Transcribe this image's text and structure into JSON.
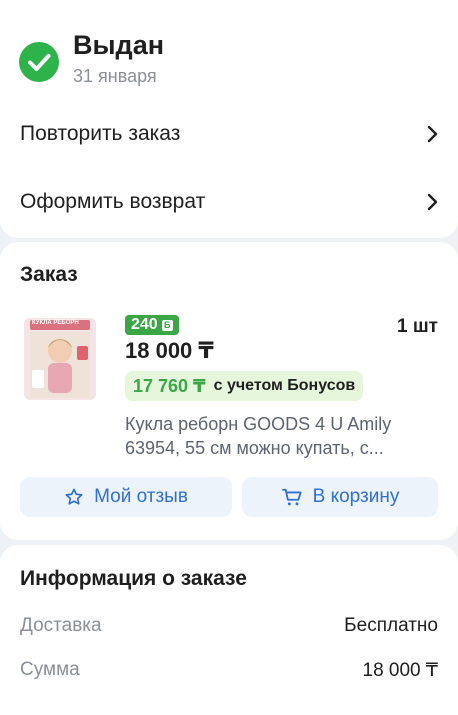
{
  "status": {
    "title": "Выдан",
    "date": "31 января",
    "actions": [
      {
        "label": "Повторить заказ"
      },
      {
        "label": "Оформить возврат"
      }
    ]
  },
  "order": {
    "section_title": "Заказ",
    "item": {
      "thumb_caption": "КУКЛА РЕБОРН",
      "bonus_badge": "240",
      "quantity": "1 шт",
      "price": "18 000 ₸",
      "bonus_price": "17 760 ₸",
      "bonus_note": "с учетом Бонусов",
      "description": "Кукла реборн GOODS 4 U Amily 63954, 55 см можно купать, с..."
    },
    "buttons": {
      "review": "Мой отзыв",
      "cart": "В корзину"
    }
  },
  "info": {
    "section_title": "Информация о заказе",
    "rows": [
      {
        "key": "Доставка",
        "value": "Бесплатно"
      },
      {
        "key": "Сумма",
        "value": "18 000 ₸"
      }
    ]
  },
  "colors": {
    "accent_green": "#2eb24a",
    "link_blue": "#2f6fd6",
    "bonus_bg": "#e6f6dd"
  },
  "icons": [
    "check-circle-icon",
    "chevron-right-icon",
    "bonus-b-icon",
    "star-outline-icon",
    "cart-icon"
  ]
}
